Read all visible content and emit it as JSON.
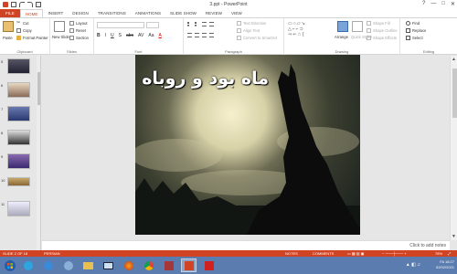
{
  "window": {
    "title": "3.ppt - PowerPoint",
    "controls": [
      "?",
      "—",
      "□",
      "✕"
    ]
  },
  "tabs": [
    "FILE",
    "HOME",
    "INSERT",
    "DESIGN",
    "TRANSITIONS",
    "ANIMATIONS",
    "SLIDE SHOW",
    "REVIEW",
    "VIEW"
  ],
  "active_tab": "HOME",
  "ribbon": {
    "clipboard": {
      "label": "Clipboard",
      "paste": "Paste",
      "cut": "Cut",
      "copy": "Copy",
      "format_painter": "Format Painter"
    },
    "slides": {
      "label": "Slides",
      "new_slide": "New Slide",
      "layout": "Layout",
      "reset": "Reset",
      "section": "Section"
    },
    "font": {
      "label": "Font",
      "bold": "B",
      "italic": "I",
      "underline": "U",
      "shadow": "S",
      "strike": "abc",
      "spacing": "AV",
      "case": "Aa",
      "color": "A"
    },
    "paragraph": {
      "label": "Paragraph",
      "text_direction": "Text Direction",
      "align_text": "Align Text",
      "smartart": "Convert to SmartArt"
    },
    "drawing": {
      "label": "Drawing",
      "arrange": "Arrange",
      "quick_styles": "Quick Styles",
      "shape_fill": "Shape Fill",
      "shape_outline": "Shape Outline",
      "shape_effects": "Shape Effects"
    },
    "editing": {
      "label": "Editing",
      "find": "Find",
      "replace": "Replace",
      "select": "Select"
    }
  },
  "thumbnails": [
    {
      "num": "5"
    },
    {
      "num": "6"
    },
    {
      "num": "7"
    },
    {
      "num": "8"
    },
    {
      "num": "9"
    },
    {
      "num": "10"
    },
    {
      "num": "11"
    }
  ],
  "slide": {
    "title": "ماه بود و روباه"
  },
  "notes_placeholder": "Click to add notes",
  "status": {
    "slide_info": "SLIDE 2 OF 18",
    "language": "PERSIAN",
    "notes": "NOTES",
    "comments": "COMMENTS",
    "zoom": "78%"
  },
  "taskbar": {
    "time": "18:27",
    "date": "02/02/2021",
    "lang": "FA"
  },
  "colors": {
    "accent": "#d04424",
    "taskbar": "#5a7cae"
  }
}
